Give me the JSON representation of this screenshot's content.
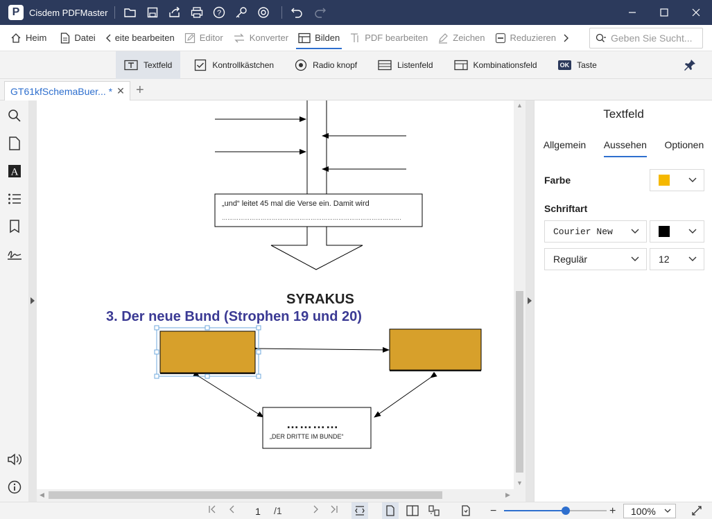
{
  "app": {
    "title": "Cisdem PDFMaster",
    "logo_letter": "P",
    "accent_color": "#2e6fce",
    "titlebar_color": "#2c3a5c"
  },
  "titlebar_icons": [
    "folder-open-icon",
    "save-icon",
    "share-icon",
    "print-icon",
    "help-icon",
    "key-icon",
    "settings-icon",
    "undo-icon",
    "redo-icon"
  ],
  "menu": {
    "home": "Heim",
    "file": "Datei",
    "edit_pages": "eite bearbeiten",
    "editor": "Editor",
    "converter": "Konverter",
    "forms": "Bilden",
    "edit_pdf": "PDF bearbeiten",
    "sign": "Zeichen",
    "reduce": "Reduzieren"
  },
  "search": {
    "placeholder": "Geben Sie Sucht..."
  },
  "form_tools": {
    "textfield": "Textfeld",
    "checkbox": "Kontrollkästchen",
    "radio": "Radio knopf",
    "listbox": "Listenfeld",
    "combobox": "Kombinationsfeld",
    "button": "Taste",
    "button_badge": "OK"
  },
  "tab": {
    "name": "GT61kfSchemaBuer... *",
    "close": "✕",
    "add": "+"
  },
  "document": {
    "box_text": "„und“ leitet 45 mal die Verse ein. Damit wird",
    "box_dots": "………………………………………………………………………………………",
    "heading": "SYRAKUS",
    "subheading": "3. Der neue Bund (Strophen 19 und 20)",
    "dots": "…………",
    "dritte": "„DER DRITTE IM BUNDE“",
    "fill_color": "#d7a02b",
    "heading_color": "#3b3a94"
  },
  "panel": {
    "title": "Textfeld",
    "tabs": {
      "general": "Allgemein",
      "appearance": "Aussehen",
      "options": "Optionen"
    },
    "color_label": "Farbe",
    "color_value": "#f5b800",
    "font_label": "Schriftart",
    "font_name": "Courier New",
    "font_color": "#000000",
    "font_style": "Regulär",
    "font_size": "12"
  },
  "status": {
    "page": "1",
    "total": "/1",
    "zoom": "100%",
    "zoom_fraction": 0.6
  }
}
